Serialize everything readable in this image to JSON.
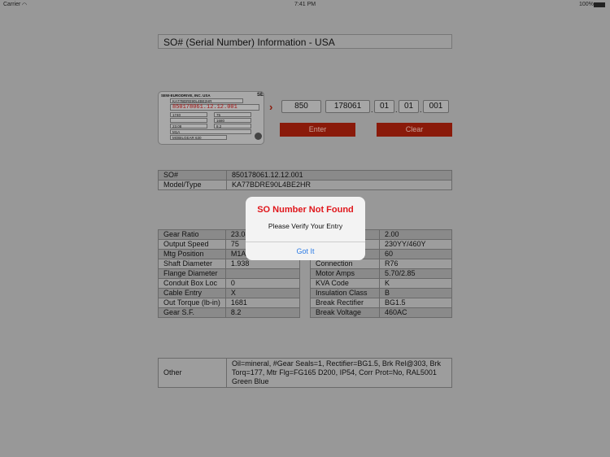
{
  "status_bar": {
    "carrier": "Carrier",
    "time": "7:41 PM",
    "battery": "100%"
  },
  "title": "SO# (Serial Number) Information - USA",
  "nameplate": {
    "company": "SEW-EURODRIVE, INC. USA",
    "logo": "SEW",
    "type": "KA77BDRE90L4BE2HR",
    "so": "850178061.12.12.001",
    "rpm_in": "1740",
    "rpm_out": "75",
    "torque": "1680",
    "ratio": "23.08",
    "service_factor": "8.2",
    "mounting": "M1A",
    "lubricant": "MOBILGEAR 630"
  },
  "so_fields": [
    "850",
    "178061",
    "01",
    "01",
    "001"
  ],
  "buttons": {
    "enter": "Enter",
    "clear": "Clear"
  },
  "summary": [
    {
      "label": "SO#",
      "value": "850178061.12.12.001"
    },
    {
      "label": "Model/Type",
      "value": "KA77BDRE90L4BE2HR"
    }
  ],
  "left_table": [
    {
      "label": "Gear Ratio",
      "value": "23.08"
    },
    {
      "label": "Output Speed",
      "value": "75"
    },
    {
      "label": "Mtg Position",
      "value": "M1A"
    },
    {
      "label": "Shaft Diameter",
      "value": "1.938"
    },
    {
      "label": "Flange Diameter",
      "value": ""
    },
    {
      "label": "Conduit Box Loc",
      "value": "0"
    },
    {
      "label": "Cable Entry",
      "value": "X"
    },
    {
      "label": "Out Torque (lb-in)",
      "value": "1681"
    },
    {
      "label": "Gear S.F.",
      "value": "8.2"
    }
  ],
  "right_table": [
    {
      "label": "",
      "value": "2.00"
    },
    {
      "label": "",
      "value": "230YY/460Y"
    },
    {
      "label": "",
      "value": "60"
    },
    {
      "label": "Connection",
      "value": "R76"
    },
    {
      "label": "Motor Amps",
      "value": "5.70/2.85"
    },
    {
      "label": "KVA Code",
      "value": "K"
    },
    {
      "label": "Insulation Class",
      "value": "B"
    },
    {
      "label": "Break Rectifier",
      "value": "BG1.5"
    },
    {
      "label": "Break Voltage",
      "value": "460AC"
    }
  ],
  "other": {
    "label": "Other",
    "value": "Oil=mineral, #Gear Seals=1, Rectifier=BG1.5, Brk Rel@303, Brk Torq=177, Mtr Flg=FG165 D200, IP54, Corr Prot=No,  RAL5001 Green Blue"
  },
  "alert": {
    "title": "SO Number Not Found",
    "message": "Please Verify Your Entry",
    "button": "Got It"
  }
}
